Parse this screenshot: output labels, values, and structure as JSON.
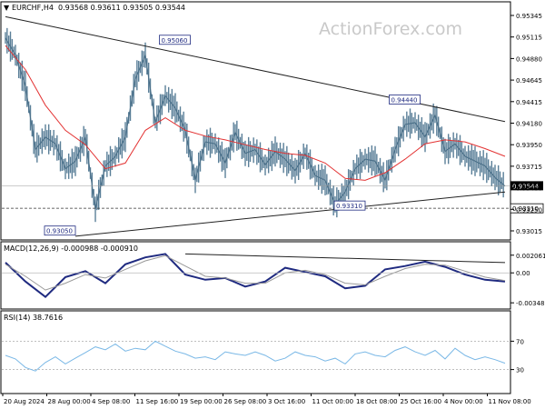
{
  "chart_data": {
    "type": "line",
    "watermark": "ActionForex.com",
    "x_ticks": [
      "20 Aug 2024",
      "28 Aug 00:00",
      "4 Sep 08:00",
      "11 Sep 16:00",
      "19 Sep 00:00",
      "26 Sep 08:00",
      "3 Oct 16:00",
      "11 Oct 00:00",
      "18 Oct 08:00",
      "25 Oct 16:00",
      "4 Nov 00:00",
      "11 Nov 08:00"
    ],
    "panels": [
      {
        "id": "price",
        "header": "EURCHF,H4  0.93568 0.93611 0.93505 0.93544",
        "ylim": [
          0.93,
          0.9536
        ],
        "y_ticks": [
          "0.95345",
          "0.95115",
          "0.94880",
          "0.94645",
          "0.94415",
          "0.94180",
          "0.93950",
          "0.93715",
          "0.93480",
          "0.93250",
          "0.93015"
        ],
        "last_price": "0.93544",
        "support_level": "0.93310",
        "series": [
          {
            "role": "close",
            "x": [
              0,
              2,
              4,
              6,
              8,
              10,
              12,
              14,
              16,
              18,
              20,
              22,
              24,
              26,
              28,
              30,
              32,
              34,
              36,
              38,
              40,
              42,
              44,
              46,
              48,
              50,
              52,
              54,
              56,
              58,
              60,
              62,
              64,
              66,
              68,
              70,
              72,
              74,
              76,
              78,
              80,
              82,
              84,
              86,
              88,
              90,
              92,
              94,
              96,
              98,
              100
            ],
            "values": [
              0.9508,
              0.949,
              0.9458,
              0.9392,
              0.9405,
              0.9398,
              0.9372,
              0.938,
              0.9405,
              0.933,
              0.9375,
              0.9385,
              0.9405,
              0.9465,
              0.949,
              0.942,
              0.9448,
              0.9435,
              0.9412,
              0.936,
              0.94,
              0.9398,
              0.9378,
              0.941,
              0.9388,
              0.9392,
              0.9376,
              0.939,
              0.9382,
              0.937,
              0.9388,
              0.9365,
              0.936,
              0.9335,
              0.9348,
              0.9372,
              0.9382,
              0.938,
              0.936,
              0.9392,
              0.9418,
              0.942,
              0.9405,
              0.9428,
              0.939,
              0.9398,
              0.9385,
              0.938,
              0.9375,
              0.9363,
              0.9354
            ]
          },
          {
            "role": "moving-average",
            "x": [
              0,
              4,
              8,
              12,
              16,
              20,
              24,
              28,
              32,
              36,
              40,
              44,
              48,
              52,
              56,
              60,
              64,
              68,
              72,
              76,
              80,
              84,
              88,
              92,
              96,
              100
            ],
            "values": [
              0.95,
              0.9475,
              0.9438,
              0.9412,
              0.9397,
              0.9372,
              0.9378,
              0.9412,
              0.9425,
              0.9412,
              0.9406,
              0.9402,
              0.9397,
              0.9392,
              0.9388,
              0.9386,
              0.9378,
              0.9362,
              0.936,
              0.9368,
              0.9382,
              0.9398,
              0.9402,
              0.94,
              0.9393,
              0.9385
            ]
          },
          {
            "role": "upper-trendline",
            "x": [
              0,
              100
            ],
            "values": [
              0.953,
              0.9421
            ]
          },
          {
            "role": "lower-trendline",
            "x": [
              14,
              100
            ],
            "values": [
              0.9302,
              0.9348
            ]
          }
        ],
        "annotations": [
          {
            "text": "0.93050",
            "x": 14,
            "y": 0.9305
          },
          {
            "text": "0.95060",
            "x": 37,
            "y": 0.9506
          },
          {
            "text": "0.93310",
            "x": 72,
            "y": 0.9331
          },
          {
            "text": "0.94440",
            "x": 83,
            "y": 0.9444
          }
        ]
      },
      {
        "id": "macd",
        "header": "MACD(12,26,9) -0.000988 -0.000910",
        "ylim": [
          -0.004,
          0.0032
        ],
        "y_ticks": [
          "0.002061",
          "0.00",
          "-0.003489"
        ],
        "series": [
          {
            "role": "macd",
            "x": [
              0,
              4,
              8,
              12,
              16,
              20,
              24,
              28,
              32,
              36,
              40,
              44,
              48,
              52,
              56,
              60,
              64,
              68,
              72,
              76,
              80,
              84,
              88,
              92,
              96,
              100
            ],
            "values": [
              0.0012,
              -0.001,
              -0.0028,
              -0.0005,
              0.0002,
              -0.0012,
              0.001,
              0.0018,
              0.0022,
              -0.0002,
              -0.0008,
              -0.0006,
              -0.0016,
              -0.001,
              0.0006,
              0.0001,
              -0.0004,
              -0.0018,
              -0.0015,
              0.0004,
              0.0008,
              0.0013,
              0.0007,
              -0.0002,
              -0.0008,
              -0.001
            ]
          },
          {
            "role": "signal",
            "x": [
              0,
              4,
              8,
              12,
              16,
              20,
              24,
              28,
              32,
              36,
              40,
              44,
              48,
              52,
              56,
              60,
              64,
              68,
              72,
              76,
              80,
              84,
              88,
              92,
              96,
              100
            ],
            "values": [
              0.001,
              -0.0004,
              -0.002,
              -0.0012,
              -0.0002,
              -0.0006,
              0.0004,
              0.0014,
              0.002,
              0.0008,
              -0.0004,
              -0.0006,
              -0.0012,
              -0.0012,
              0.0,
              0.0003,
              -0.0002,
              -0.0012,
              -0.0014,
              -0.0004,
              0.0005,
              0.001,
              0.0009,
              0.0002,
              -0.0005,
              -0.0009
            ]
          },
          {
            "role": "trendline",
            "x": [
              36,
              100
            ],
            "values": [
              0.0022,
              0.0012
            ]
          }
        ]
      },
      {
        "id": "rsi",
        "header": "RSI(14) 38.7616",
        "ylim": [
          0,
          100
        ],
        "y_ticks": [
          "70",
          "30"
        ],
        "levels": [
          70,
          30
        ],
        "series": [
          {
            "role": "rsi",
            "x": [
              0,
              2,
              4,
              6,
              8,
              10,
              12,
              14,
              16,
              18,
              20,
              22,
              24,
              26,
              28,
              30,
              32,
              34,
              36,
              38,
              40,
              42,
              44,
              46,
              48,
              50,
              52,
              54,
              56,
              58,
              60,
              62,
              64,
              66,
              68,
              70,
              72,
              74,
              76,
              78,
              80,
              82,
              84,
              86,
              88,
              90,
              92,
              94,
              96,
              98,
              100
            ],
            "values": [
              50,
              45,
              33,
              28,
              40,
              48,
              38,
              46,
              54,
              62,
              58,
              66,
              56,
              60,
              58,
              70,
              63,
              56,
              52,
              46,
              48,
              44,
              55,
              52,
              50,
              55,
              50,
              42,
              46,
              55,
              50,
              48,
              42,
              46,
              38,
              52,
              55,
              50,
              48,
              57,
              62,
              55,
              50,
              57,
              45,
              60,
              50,
              44,
              48,
              44,
              39
            ]
          }
        ]
      }
    ]
  }
}
